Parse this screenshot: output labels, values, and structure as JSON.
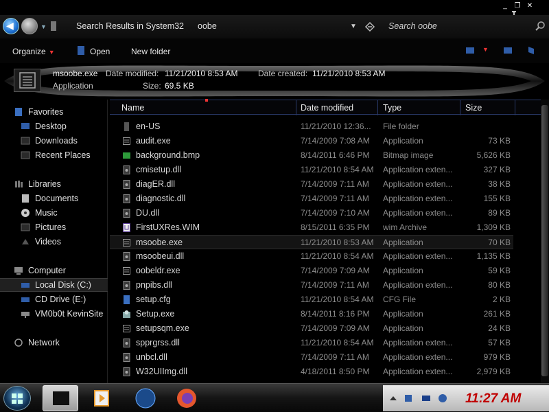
{
  "window": {
    "minimize": "_",
    "restore": "❐",
    "close": "✕"
  },
  "address": {
    "breadcrumb": [
      "Search Results in System32",
      "oobe"
    ],
    "search_placeholder": "Search oobe"
  },
  "toolbar": {
    "organize": "Organize",
    "open": "Open",
    "new_folder": "New folder"
  },
  "details": {
    "filename": "msoobe.exe",
    "modified_label": "Date modified:",
    "modified_value": "11/21/2010 8:53 AM",
    "created_label": "Date created:",
    "created_value": "11/21/2010 8:53 AM",
    "type": "Application",
    "size_label": "Size:",
    "size_value": "69.5 KB"
  },
  "nav": {
    "favorites": "Favorites",
    "desktop": "Desktop",
    "downloads": "Downloads",
    "recent_places": "Recent Places",
    "libraries": "Libraries",
    "documents": "Documents",
    "music": "Music",
    "pictures": "Pictures",
    "videos": "Videos",
    "computer": "Computer",
    "local_disk": "Local Disk (C:)",
    "cd_drive": "CD Drive (E:)",
    "vm_share": "VM0b0t KevinSite",
    "network": "Network"
  },
  "columns": {
    "name": "Name",
    "date": "Date modified",
    "type": "Type",
    "size": "Size"
  },
  "files": [
    {
      "name": "en-US",
      "date": "11/21/2010 12:36...",
      "type": "File folder",
      "size": "",
      "icon": "folder-icon"
    },
    {
      "name": "audit.exe",
      "date": "7/14/2009 7:08 AM",
      "type": "Application",
      "size": "73 KB",
      "icon": "exe-icon"
    },
    {
      "name": "background.bmp",
      "date": "8/14/2011 6:46 PM",
      "type": "Bitmap image",
      "size": "5,626 KB",
      "icon": "image-icon"
    },
    {
      "name": "cmisetup.dll",
      "date": "11/21/2010 8:54 AM",
      "type": "Application exten...",
      "size": "327 KB",
      "icon": "dll-icon"
    },
    {
      "name": "diagER.dll",
      "date": "7/14/2009 7:11 AM",
      "type": "Application exten...",
      "size": "38 KB",
      "icon": "dll-icon"
    },
    {
      "name": "diagnostic.dll",
      "date": "7/14/2009 7:11 AM",
      "type": "Application exten...",
      "size": "155 KB",
      "icon": "dll-icon"
    },
    {
      "name": "DU.dll",
      "date": "7/14/2009 7:10 AM",
      "type": "Application exten...",
      "size": "89 KB",
      "icon": "dll-icon"
    },
    {
      "name": "FirstUXRes.WIM",
      "date": "8/15/2011 6:35 PM",
      "type": "wim Archive",
      "size": "1,309 KB",
      "icon": "archive-icon"
    },
    {
      "name": "msoobe.exe",
      "date": "11/21/2010 8:53 AM",
      "type": "Application",
      "size": "70 KB",
      "icon": "exe-icon",
      "selected": true
    },
    {
      "name": "msoobeui.dll",
      "date": "11/21/2010 8:54 AM",
      "type": "Application exten...",
      "size": "1,135 KB",
      "icon": "dll-icon"
    },
    {
      "name": "oobeldr.exe",
      "date": "7/14/2009 7:09 AM",
      "type": "Application",
      "size": "59 KB",
      "icon": "exe-icon"
    },
    {
      "name": "pnpibs.dll",
      "date": "7/14/2009 7:11 AM",
      "type": "Application exten...",
      "size": "80 KB",
      "icon": "dll-icon"
    },
    {
      "name": "setup.cfg",
      "date": "11/21/2010 8:54 AM",
      "type": "CFG File",
      "size": "2 KB",
      "icon": "cfg-icon"
    },
    {
      "name": "Setup.exe",
      "date": "8/14/2011 8:16 PM",
      "type": "Application",
      "size": "261 KB",
      "icon": "setup-icon"
    },
    {
      "name": "setupsqm.exe",
      "date": "7/14/2009 7:09 AM",
      "type": "Application",
      "size": "24 KB",
      "icon": "exe-icon"
    },
    {
      "name": "spprgrss.dll",
      "date": "11/21/2010 8:54 AM",
      "type": "Application exten...",
      "size": "57 KB",
      "icon": "dll-icon"
    },
    {
      "name": "unbcl.dll",
      "date": "7/14/2009 7:11 AM",
      "type": "Application exten...",
      "size": "979 KB",
      "icon": "dll-icon"
    },
    {
      "name": "W32UIImg.dll",
      "date": "4/18/2011 8:50 PM",
      "type": "Application exten...",
      "size": "2,979 KB",
      "icon": "dll-icon"
    }
  ],
  "taskbar": {
    "clock": "11:27 AM"
  },
  "colors": {
    "accent": "#2a3a6a",
    "clock": "#c00000"
  }
}
